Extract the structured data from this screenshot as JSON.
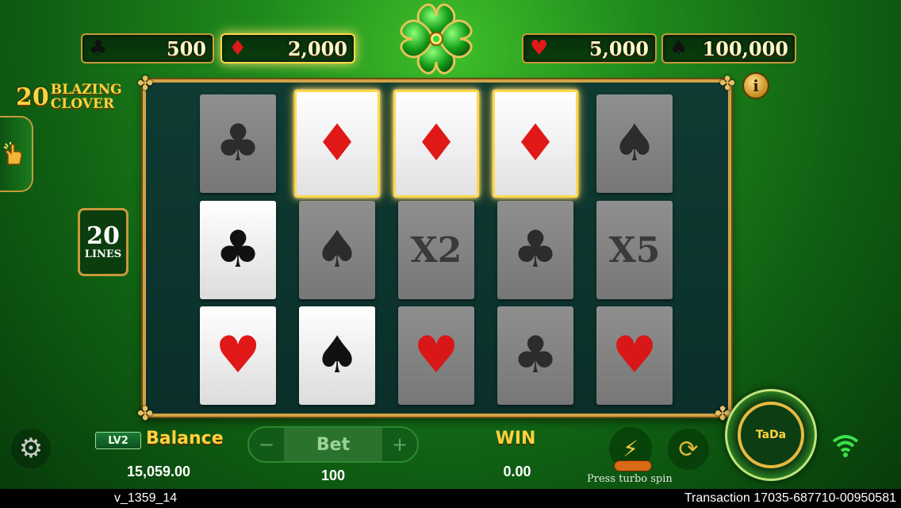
{
  "jackpots": [
    {
      "suit": "club",
      "glyph": "♣",
      "value": "500",
      "highlighted": false
    },
    {
      "suit": "diamond",
      "glyph": "♦",
      "value": "2,000",
      "highlighted": true
    },
    {
      "suit": "heart",
      "glyph": "♥",
      "value": "5,000",
      "highlighted": false
    },
    {
      "suit": "spade",
      "glyph": "♠",
      "value": "100,000",
      "highlighted": false
    }
  ],
  "logo": {
    "number": "20",
    "line1": "BLAZING",
    "line2": "CLOVER"
  },
  "lines_badge": {
    "count": "20",
    "label": "LINES"
  },
  "reels": [
    [
      {
        "symbol": "club",
        "state": "dim"
      },
      {
        "symbol": "club",
        "state": "lit"
      },
      {
        "symbol": "heart",
        "state": "lit"
      }
    ],
    [
      {
        "symbol": "diamond",
        "state": "win"
      },
      {
        "symbol": "spade",
        "state": "dim"
      },
      {
        "symbol": "spade",
        "state": "lit"
      }
    ],
    [
      {
        "symbol": "diamond",
        "state": "win"
      },
      {
        "symbol": "X2",
        "state": "dim"
      },
      {
        "symbol": "heart",
        "state": "dim"
      }
    ],
    [
      {
        "symbol": "diamond",
        "state": "win"
      },
      {
        "symbol": "club",
        "state": "dim"
      },
      {
        "symbol": "club",
        "state": "dim"
      }
    ],
    [
      {
        "symbol": "spade",
        "state": "dim"
      },
      {
        "symbol": "X5",
        "state": "dim"
      },
      {
        "symbol": "heart",
        "state": "dim"
      }
    ]
  ],
  "bottom": {
    "level": "LV2",
    "balance_label": "Balance",
    "balance_value": "15,059.00",
    "bet_label": "Bet",
    "bet_minus": "−",
    "bet_plus": "+",
    "bet_value": "100",
    "win_label": "WIN",
    "win_value": "0.00",
    "turbo_text": "Press turbo spin",
    "spin_label": "TaDa"
  },
  "footer": {
    "version": "v_1359_14",
    "transaction": "Transaction 17035-687710-00950581"
  },
  "colors": {
    "win_glow": "#ffd84a",
    "frame": "#d2a247",
    "accent_gold": "#ffd23f"
  }
}
